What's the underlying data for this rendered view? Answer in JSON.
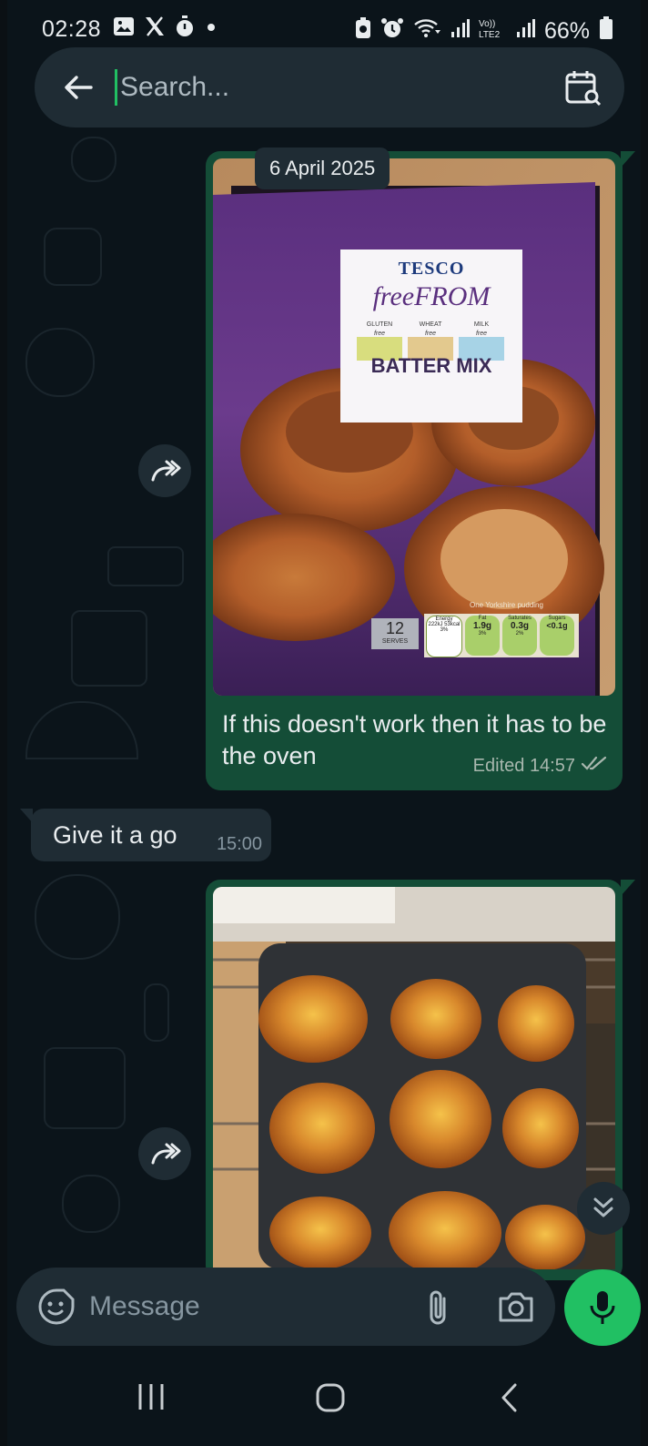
{
  "status_bar": {
    "time": "02:28",
    "battery": "66%",
    "icons": [
      "gallery-icon",
      "x-icon",
      "timer-icon",
      "dot-icon",
      "battery-saver-icon",
      "alarm-icon",
      "wifi-icon",
      "signal-icon",
      "volte-icon",
      "signal-icon",
      "battery-icon"
    ]
  },
  "search": {
    "placeholder": "Search..."
  },
  "chat": {
    "date_chip": "6 April 2025",
    "messages": [
      {
        "direction": "outgoing",
        "type": "image",
        "image": {
          "brand": "TESCO",
          "line": "freeFROM",
          "free_badges": [
            {
              "label": "GLUTEN",
              "sub": "free"
            },
            {
              "label": "WHEAT",
              "sub": "free"
            },
            {
              "label": "MILK",
              "sub": "free"
            }
          ],
          "product": "BATTER MIX",
          "serves": "12",
          "serves_label": "SERVES",
          "nutrition_header": "One Yorkshire pudding",
          "nutrition": [
            {
              "name": "Energy",
              "value": "222kJ 53kcal",
              "pct": "3%"
            },
            {
              "name": "Fat",
              "value": "1.9g",
              "pct": "3%"
            },
            {
              "name": "Saturates",
              "value": "0.3g",
              "pct": "2%"
            },
            {
              "name": "Sugars",
              "value": "<0.1g",
              "pct": ""
            }
          ]
        },
        "caption": "If this doesn't work then it has to be the oven",
        "meta": "Edited 14:57"
      },
      {
        "direction": "incoming",
        "type": "text",
        "text": "Give it a go",
        "time": "15:00"
      },
      {
        "direction": "outgoing",
        "type": "image",
        "image_description_icon": "photo"
      }
    ]
  },
  "composer": {
    "placeholder": "Message"
  },
  "colors": {
    "background": "#0b141a",
    "outgoing_bubble": "#144d37",
    "incoming_bubble": "#1f2c34",
    "accent_green": "#21c063",
    "read_ticks": "#a8b7ae"
  }
}
